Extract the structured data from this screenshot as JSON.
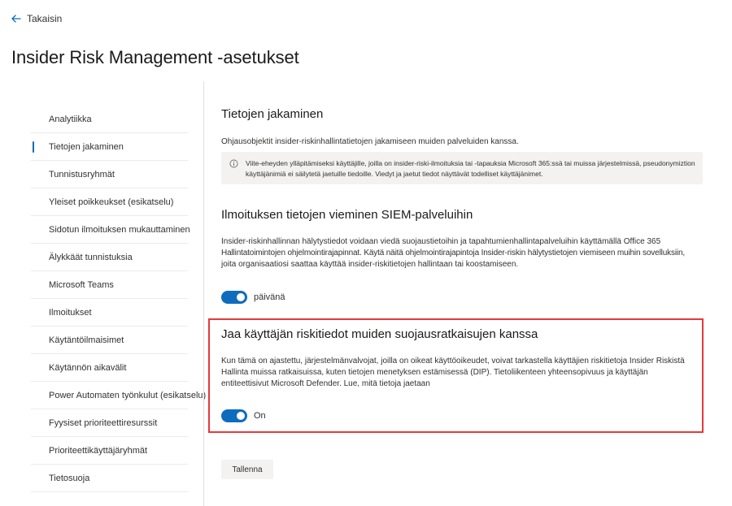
{
  "header": {
    "back_label": "Takaisin",
    "title": "Insider Risk Management -asetukset"
  },
  "sidebar": {
    "selected_index": 1,
    "items": [
      {
        "label": "Analytiikka"
      },
      {
        "label": "Tietojen jakaminen"
      },
      {
        "label": "Tunnistusryhmät"
      },
      {
        "label": "Yleiset poikkeukset (esikatselu)"
      },
      {
        "label": "Sidotun ilmoituksen mukauttaminen"
      },
      {
        "label": "Älykkäät tunnistuksia"
      },
      {
        "label": "Microsoft Teams"
      },
      {
        "label": "Ilmoitukset"
      },
      {
        "label": "Käytäntöilmaisimet"
      },
      {
        "label": "Käytännön aikavälit"
      },
      {
        "label": "Power Automaten työnkulut (esikatselu)"
      },
      {
        "label": "Fyysiset prioriteettiresurssit"
      },
      {
        "label": "Prioriteettikäyttäjäryhmät"
      },
      {
        "label": "Tietosuoja"
      }
    ]
  },
  "main": {
    "sharing": {
      "title": "Tietojen jakaminen",
      "description": "Ohjausobjektit insider-riskinhallintatietojen jakamiseen muiden palveluiden kanssa.",
      "info_line1": "Viite-eheyden ylläpitämiseksi käyttäjille, joilla on insider-riski-ilmoituksia tai -tapauksia Microsoft 365:ssä tai muissa järjestelmissä, pseudonymiztion",
      "info_line2": "käyttäjänimiä ei säilytetä jaetuille tiedoille. Viedyt ja jaetut tiedot näyttävät todelliset käyttäjänimet."
    },
    "siem": {
      "title": "Ilmoituksen tietojen vieminen SIEM-palveluihin",
      "desc_line1": "Insider-riskinhallinnan hälytystiedot voidaan viedä suojaustietoihin ja tapahtumienhallintapalveluihin käyttämällä Office 365",
      "desc_line2": "Hallintatoimintojen ohjelmointirajapinnat. Käytä näitä ohjelmointirajapintoja Insider-riskin hälytystietojen viemiseen muihin sovelluksiin,",
      "desc_line3": "joita organisaatiosi saattaa käyttää insider-riskitietojen hallintaan tai koostamiseen.",
      "toggle_label": "päivänä"
    },
    "share_risk": {
      "title": "Jaa käyttäjän riskitiedot muiden suojausratkaisujen kanssa",
      "desc_line1": "Kun tämä on ajastettu, järjestelmänvalvojat, joilla on oikeat käyttöoikeudet, voivat tarkastella käyttäjien riskitietoja Insider Riskistä",
      "desc_line2": "Hallinta muissa ratkaisuissa, kuten tietojen menetyksen estämisessä (DIP). Tietoliikenteen yhteensopivuus ja käyttäjän",
      "desc_line3": "entiteettisivut Microsoft Defender. Lue, mitä tietoja jaetaan",
      "toggle_label": "On"
    },
    "save_label": "Tallenna"
  },
  "colors": {
    "accent": "#0f6cbd",
    "highlight_border": "#e5393b"
  }
}
